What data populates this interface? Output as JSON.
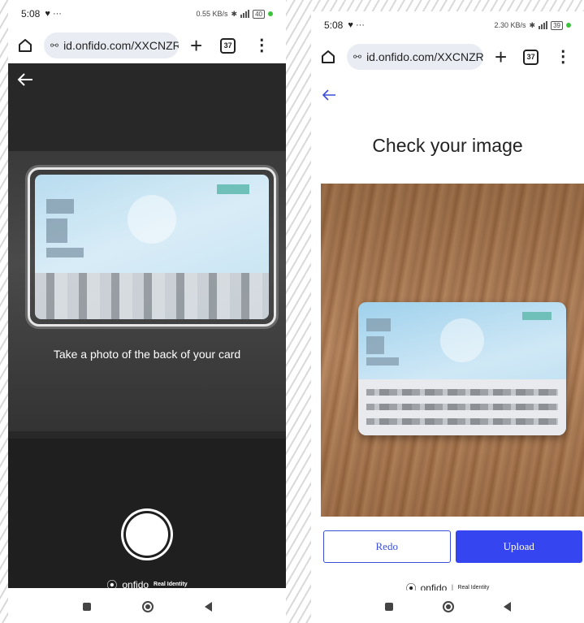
{
  "status_bar": {
    "time": "5:08",
    "net_speed_a": "0.55 KB/s",
    "net_speed_b": "2.30 KB/s",
    "battery_a": "40",
    "battery_b": "39"
  },
  "browser": {
    "url": "id.onfido.com/XXCNZRC",
    "tab_count": "37",
    "new_tab_symbol": "+",
    "menu_symbol": "⋮"
  },
  "capture_screen": {
    "instruction": "Take a photo of the back of your card"
  },
  "review_screen": {
    "title": "Check your image",
    "redo_label": "Redo",
    "upload_label": "Upload"
  },
  "branding": {
    "logo_text": "onfido",
    "tagline": "Real Identity",
    "separator": "|"
  },
  "colors": {
    "upload_button": "#3546f0",
    "redo_border": "#3a4fd6",
    "camera_bg": "#282828"
  },
  "icons": [
    "home-icon",
    "tune-icon",
    "back-arrow-icon",
    "nav-recents-icon",
    "nav-home-icon",
    "nav-back-icon",
    "onfido-logo-icon"
  ]
}
